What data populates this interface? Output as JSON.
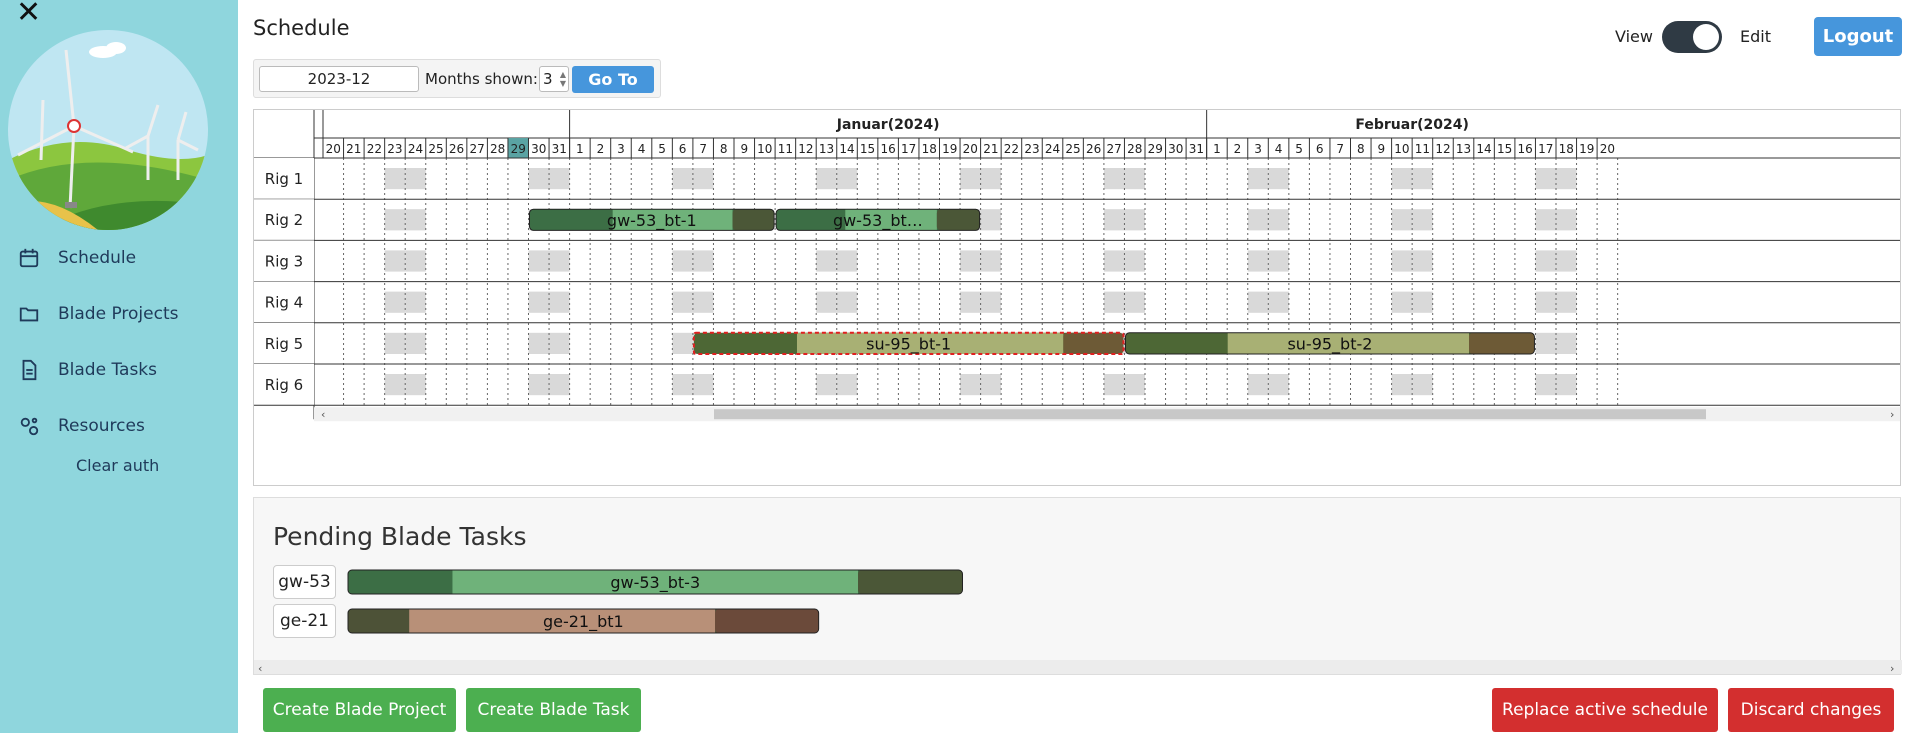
{
  "sidebar": {
    "close_icon": "close-icon",
    "nav": [
      {
        "label": "Schedule",
        "icon": "calendar-icon"
      },
      {
        "label": "Blade Projects",
        "icon": "folder-icon"
      },
      {
        "label": "Blade Tasks",
        "icon": "document-icon"
      },
      {
        "label": "Resources",
        "icon": "gears-icon"
      }
    ],
    "clear_auth": "Clear auth"
  },
  "header": {
    "title": "Schedule",
    "view_label": "View",
    "edit_label": "Edit",
    "mode": "edit",
    "logout": "Logout"
  },
  "datebar": {
    "date_value": "2023-12",
    "months_label": "Months shown:",
    "months_value": "3",
    "goto_label": "Go To"
  },
  "gantt": {
    "months": [
      {
        "label": "",
        "days": [
          "20",
          "21",
          "22",
          "23",
          "24",
          "25",
          "26",
          "27",
          "28",
          "29",
          "30",
          "31"
        ]
      },
      {
        "label": "Januar(2024)",
        "days": [
          "1",
          "2",
          "3",
          "4",
          "5",
          "6",
          "7",
          "8",
          "9",
          "10",
          "11",
          "12",
          "13",
          "14",
          "15",
          "16",
          "17",
          "18",
          "19",
          "20",
          "21",
          "22",
          "23",
          "24",
          "25",
          "26",
          "27",
          "28",
          "29",
          "30",
          "31"
        ]
      },
      {
        "label": "Februar(2024)",
        "days": [
          "1",
          "2",
          "3",
          "4",
          "5",
          "6",
          "7",
          "8",
          "9",
          "10",
          "11",
          "12",
          "13",
          "14",
          "15",
          "16",
          "17",
          "18",
          "19",
          "20"
        ]
      }
    ],
    "today_index": 9,
    "weekend_indices": [
      3,
      4,
      10,
      11,
      17,
      18,
      24,
      25,
      31,
      32,
      38,
      39,
      45,
      46,
      52,
      53,
      59,
      60
    ],
    "rigs": [
      "Rig 1",
      "Rig 2",
      "Rig 3",
      "Rig 4",
      "Rig 5",
      "Rig 6"
    ],
    "tasks": [
      {
        "rig": 1,
        "start": 10,
        "end": 22,
        "label": "gw-53_bt-1",
        "mid_from": 0.34,
        "mid_to": 0.83,
        "outer": "#3c6e45",
        "inner": "#6fb27a",
        "tail": "#4b5737",
        "selected": false
      },
      {
        "rig": 1,
        "start": 22,
        "end": 32,
        "label": "gw-53_bt…",
        "mid_from": 0.34,
        "mid_to": 0.79,
        "outer": "#3c6e45",
        "inner": "#6fb27a",
        "tail": "#4b5737",
        "selected": false
      },
      {
        "rig": 4,
        "start": 18,
        "end": 39,
        "label": "su-95_bt-1",
        "mid_from": 0.24,
        "mid_to": 0.86,
        "outer": "#4d6735",
        "inner": "#a8b074",
        "tail": "#6d5a36",
        "selected": true
      },
      {
        "rig": 4,
        "start": 39,
        "end": 59,
        "label": "su-95_bt-2",
        "mid_from": 0.25,
        "mid_to": 0.84,
        "outer": "#4d6735",
        "inner": "#a8b074",
        "tail": "#6d5a36",
        "selected": false
      }
    ]
  },
  "pending": {
    "title": "Pending Blade Tasks",
    "rows": [
      {
        "code": "gw-53",
        "label": "gw-53_bt-3",
        "outer": "#3c6e45",
        "inner": "#6fb27a",
        "tail": "#4b5737",
        "span": 30,
        "mid_from": 0.17,
        "mid_to": 0.83
      },
      {
        "code": "ge-21",
        "label": "ge-21_bt1",
        "outer": "#4d5237",
        "inner": "#b89078",
        "tail": "#6b4a3a",
        "span": 23,
        "mid_from": 0.13,
        "mid_to": 0.78
      }
    ]
  },
  "buttons": {
    "create_project": "Create Blade Project",
    "create_task": "Create Blade Task",
    "replace": "Replace active schedule",
    "discard": "Discard changes"
  },
  "colors": {
    "sidebar": "#8fd6dd",
    "primary": "#4696dc",
    "success": "#4caf50",
    "danger": "#d32f2f",
    "today": "#5aa3a3",
    "weekend": "#d9d9d9"
  }
}
